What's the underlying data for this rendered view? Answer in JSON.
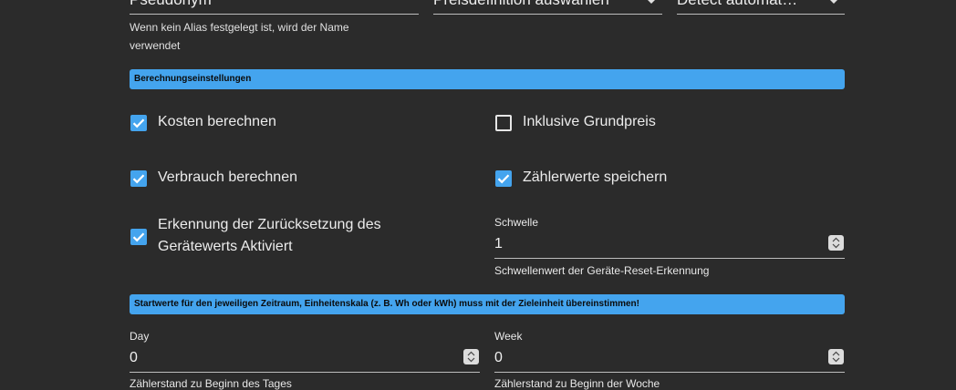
{
  "top_fields": {
    "alias_value": "Pseudonym",
    "price_value": "Preisdefinition auswählen",
    "detect_value": "Detect automat…",
    "alias_helper": "Wenn kein Alias festgelegt ist, wird der Name verwendet"
  },
  "calc_section": {
    "title": "Berechnungseinstellungen",
    "cost_label": "Kosten berechnen",
    "cost_checked": true,
    "base_price_label": "Inklusive Grundpreis",
    "base_price_checked": false,
    "consumption_label": "Verbrauch berechnen",
    "consumption_checked": true,
    "store_meter_label": "Zählerwerte speichern",
    "store_meter_checked": true,
    "reset_detect_label": "Erkennung der Zurücksetzung des Gerätewerts Aktiviert",
    "reset_detect_checked": true,
    "threshold_label": "Schwelle",
    "threshold_value": "1",
    "threshold_helper": "Schwellenwert der Geräte-Reset-Erkennung"
  },
  "start_section": {
    "title": "Startwerte für den jeweiligen Zeitraum, Einheitenskala (z. B. Wh oder kWh) muss mit der Zieleinheit übereinstimmen!",
    "day_label": "Day",
    "day_value": "0",
    "day_helper": "Zählerstand zu Beginn des Tages",
    "week_label": "Week",
    "week_value": "0",
    "week_helper": "Zählerstand zu Beginn der Woche"
  },
  "colors": {
    "background": "#2b2b2b",
    "accent": "#44a4ee"
  }
}
